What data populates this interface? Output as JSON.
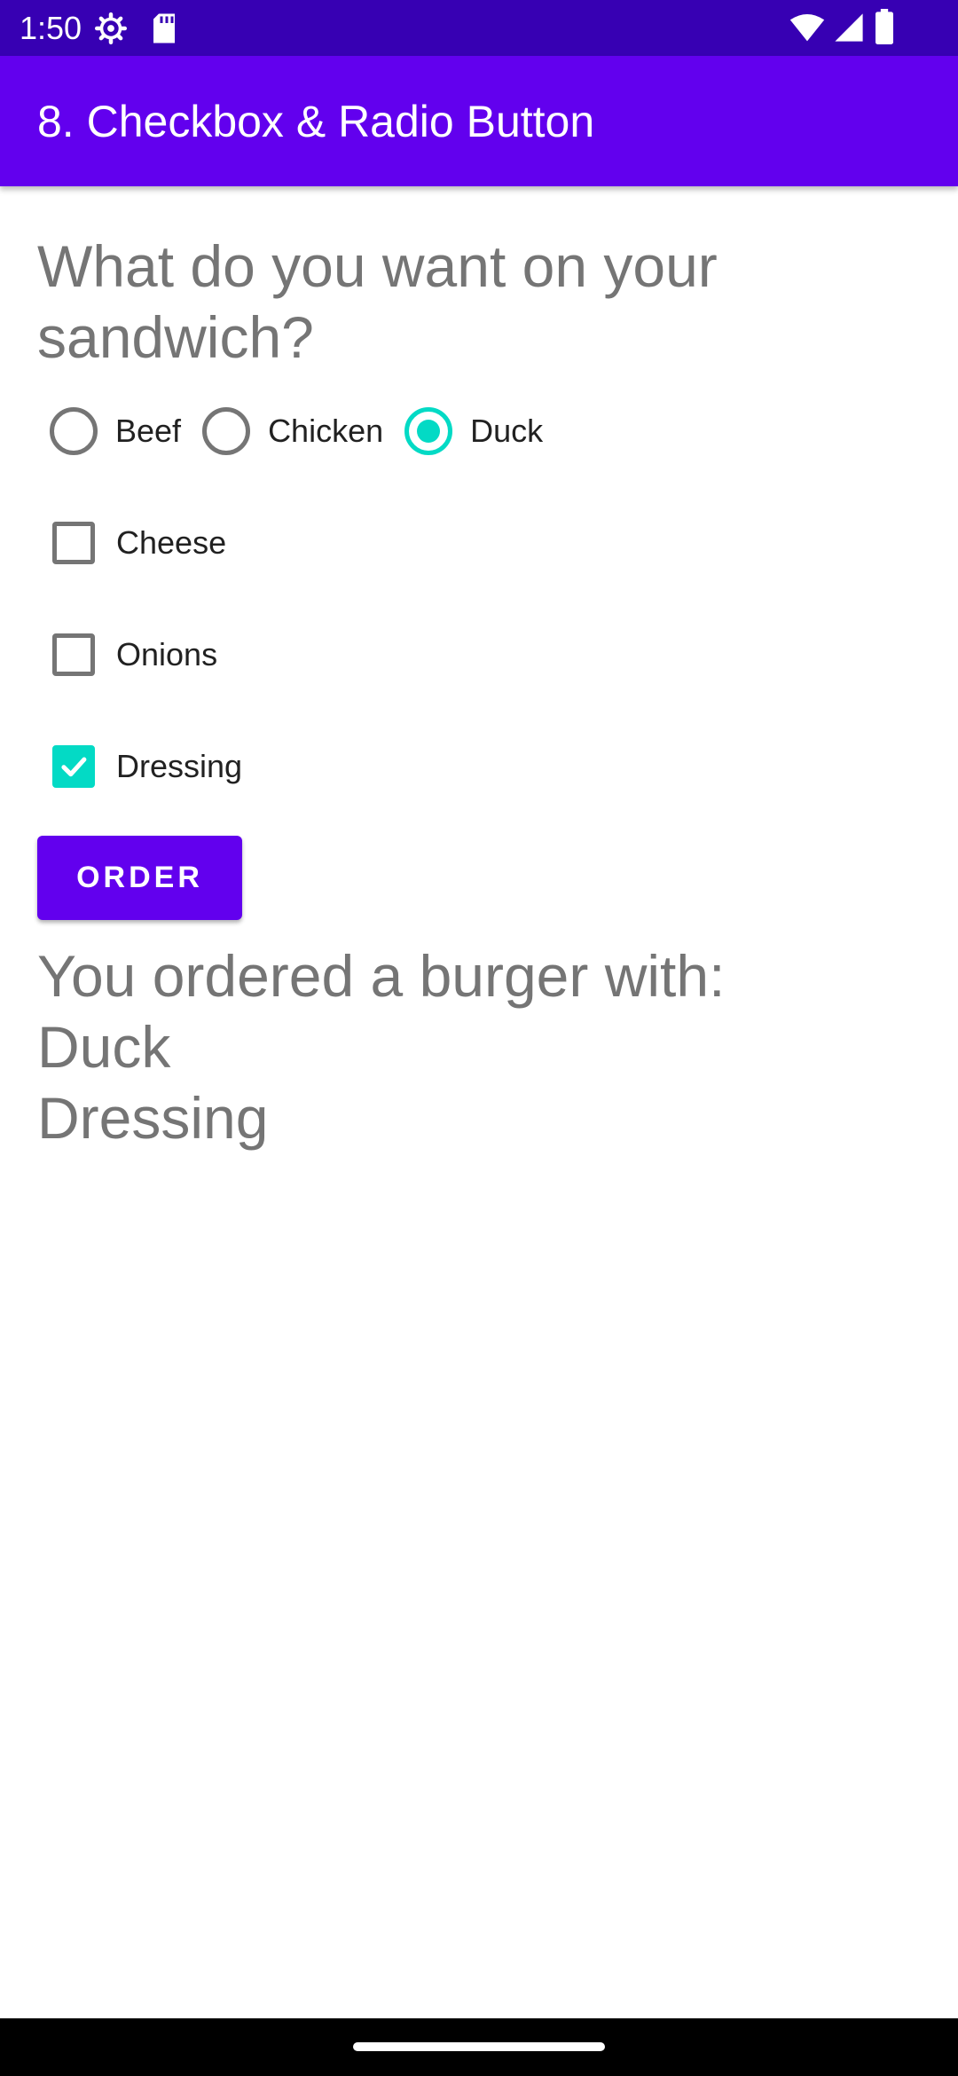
{
  "status_bar": {
    "time": "1:50",
    "left_icons": [
      "settings-gear-icon",
      "sd-card-icon"
    ],
    "right_icons": [
      "wifi-icon",
      "cellular-signal-icon",
      "battery-icon"
    ]
  },
  "app_bar": {
    "title": "8. Checkbox & Radio Button"
  },
  "question": "What do you want on your sandwich?",
  "radios": [
    {
      "label": "Beef",
      "checked": false
    },
    {
      "label": "Chicken",
      "checked": false
    },
    {
      "label": "Duck",
      "checked": true
    }
  ],
  "checkboxes": [
    {
      "label": "Cheese",
      "checked": false
    },
    {
      "label": "Onions",
      "checked": false
    },
    {
      "label": "Dressing",
      "checked": true
    }
  ],
  "order_button": {
    "label": "ORDER"
  },
  "result": {
    "lines": [
      "You ordered a burger with:",
      "Duck",
      "Dressing"
    ]
  },
  "colors": {
    "primary": "#6200ee",
    "primary_dark": "#3700b3",
    "accent": "#03dac5",
    "text_secondary": "#757575"
  }
}
